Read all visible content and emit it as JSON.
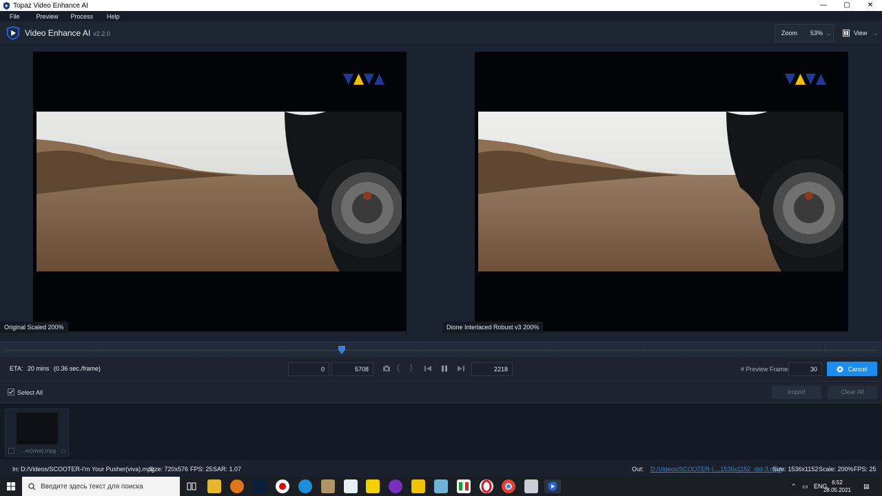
{
  "window": {
    "title": "Topaz Video Enhance AI",
    "controls": [
      "—",
      "▢",
      "✕"
    ]
  },
  "menu": [
    "File",
    "Preview",
    "Process",
    "Help"
  ],
  "header": {
    "app_name": "Video Enhance AI",
    "version": "v2.2.0",
    "zoom_label": "Zoom",
    "zoom_value": "53%",
    "view_label": "View"
  },
  "preview": {
    "left_label": "Original Scaled 200%",
    "right_label": "Dione Interlaced Robust v3 200%"
  },
  "timeline": {
    "position_fraction": 0.386
  },
  "controls": {
    "eta_label": "ETA:",
    "eta_value": "20 mins",
    "eta_rate": "(0.36 sec./frame)",
    "start_frame": "0",
    "end_frame": "5708",
    "current_frame": "2218",
    "preview_frames_label": "# Preview Frames",
    "preview_frames_value": "30",
    "cancel_label": "Cancel"
  },
  "selection": {
    "select_all_label": "Select All",
    "import_label": "Import",
    "clear_all_label": "Clear All"
  },
  "files": [
    {
      "name": "...er(viva).mpg"
    }
  ],
  "status": {
    "in_label": "In:",
    "in_path": "D:/Videos/SCOOTER-I'm Your Pusher(viva).mpg",
    "in_size": "Size: 720x576",
    "in_fps": "FPS: 25",
    "in_sar": "SAR: 1.07",
    "out_label": "Out:",
    "out_path": "D:/Videos/SCOOTER-I....1536x1152_dtd-3.mp4",
    "out_size": "Size: 1536x1152",
    "out_scale": "Scale: 200%",
    "out_fps": "FPS: 25"
  },
  "taskbar": {
    "search_placeholder": "Введите здесь текст для поиска",
    "lang": "ENG",
    "time": "6:52",
    "date": "28.05.2021"
  },
  "colors": {
    "accent": "#1a8ef0",
    "background": "#1c2330",
    "viva_blue": "#1f3a93",
    "viva_yellow": "#f2c200"
  }
}
